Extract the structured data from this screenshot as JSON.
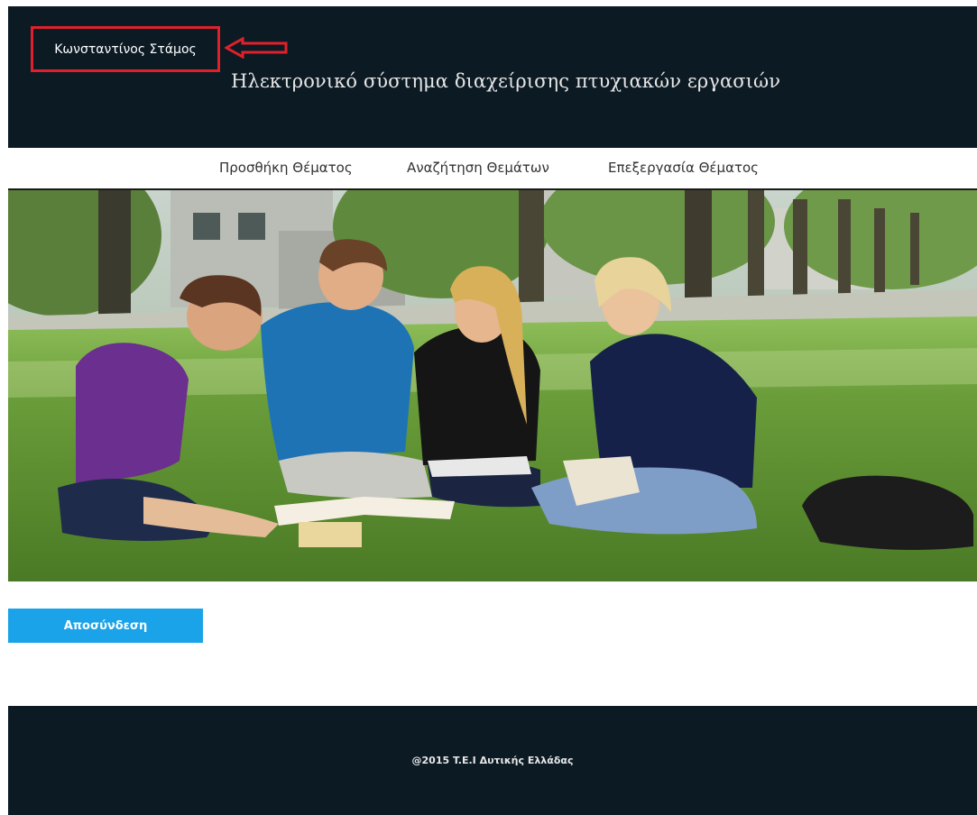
{
  "header": {
    "user_name": "Κωνσταντίνος Στάμος",
    "title": "Ηλεκτρονικό σύστημα διαχείρισης πτυχιακών εργασιών"
  },
  "nav": {
    "items": [
      {
        "label": "Προσθήκη Θέματος"
      },
      {
        "label": "Αναζήτηση Θεμάτων"
      },
      {
        "label": "Επεξεργασία Θέματος"
      }
    ]
  },
  "hero": {
    "icon": "students-photo"
  },
  "actions": {
    "logout_label": "Αποσύνδεση"
  },
  "footer": {
    "copyright": "@2015 T.E.I Δυτικής Ελλάδας"
  },
  "colors": {
    "header_bg": "#0c1a24",
    "accent": "#1aa3e8",
    "highlight": "#e0202a"
  }
}
